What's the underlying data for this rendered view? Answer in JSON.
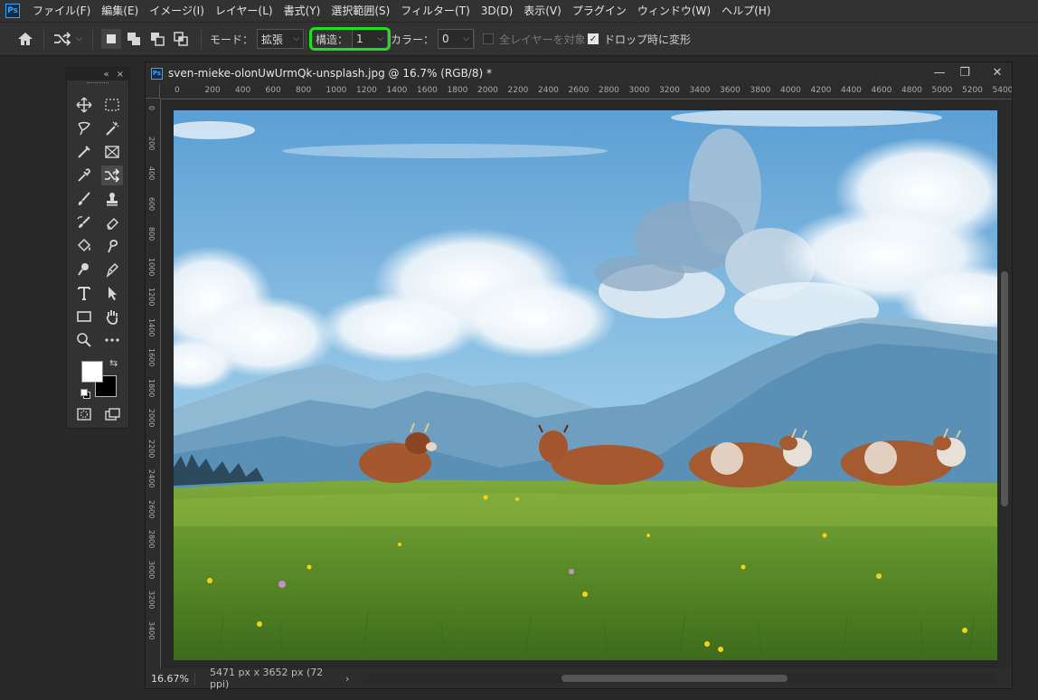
{
  "app": {
    "logo": "Ps",
    "menu": [
      "ファイル(F)",
      "編集(E)",
      "イメージ(I)",
      "レイヤー(L)",
      "書式(Y)",
      "選択範囲(S)",
      "フィルター(T)",
      "3D(D)",
      "表示(V)",
      "プラグイン",
      "ウィンドウ(W)",
      "ヘルプ(H)"
    ]
  },
  "options": {
    "mode_label": "モード：",
    "mode_value": "拡張",
    "structure_label": "構造：",
    "structure_value": "1",
    "color_label": "カラー：",
    "color_value": "0",
    "all_layers_label": "全レイヤーを対象",
    "all_layers_checked": false,
    "transform_on_drop_label": "ドロップ時に変形",
    "transform_on_drop_checked": true,
    "highlight_color": "#1ee01e"
  },
  "tools_panel": {
    "collapse_glyph": "«",
    "close_glyph": "×",
    "foreground_color": "#ffffff",
    "background_color": "#000000"
  },
  "document": {
    "title": "sven-mieke-olonUwUrmQk-unsplash.jpg @ 16.7% (RGB/8) *",
    "zoom": "16.67%",
    "info": "5471 px x 3652 px (72 ppi)",
    "status_arrow": "›",
    "hruler_labels": [
      "0",
      "200",
      "400",
      "600",
      "800",
      "1000",
      "1200",
      "1400",
      "1600",
      "1800",
      "2000",
      "2200",
      "2400",
      "2600",
      "2800",
      "3000",
      "3200",
      "3400",
      "3600",
      "3800",
      "4000",
      "4200",
      "4400",
      "4600",
      "4800",
      "5000",
      "5200",
      "5400"
    ],
    "vruler_labels": [
      "0",
      "200",
      "400",
      "600",
      "800",
      "1000",
      "1200",
      "1400",
      "1600",
      "1800",
      "2000",
      "2200",
      "2400",
      "2600",
      "2800",
      "3000",
      "3200",
      "3400"
    ]
  },
  "window_controls": {
    "minimize": "—",
    "restore": "❐",
    "close": "✕"
  }
}
